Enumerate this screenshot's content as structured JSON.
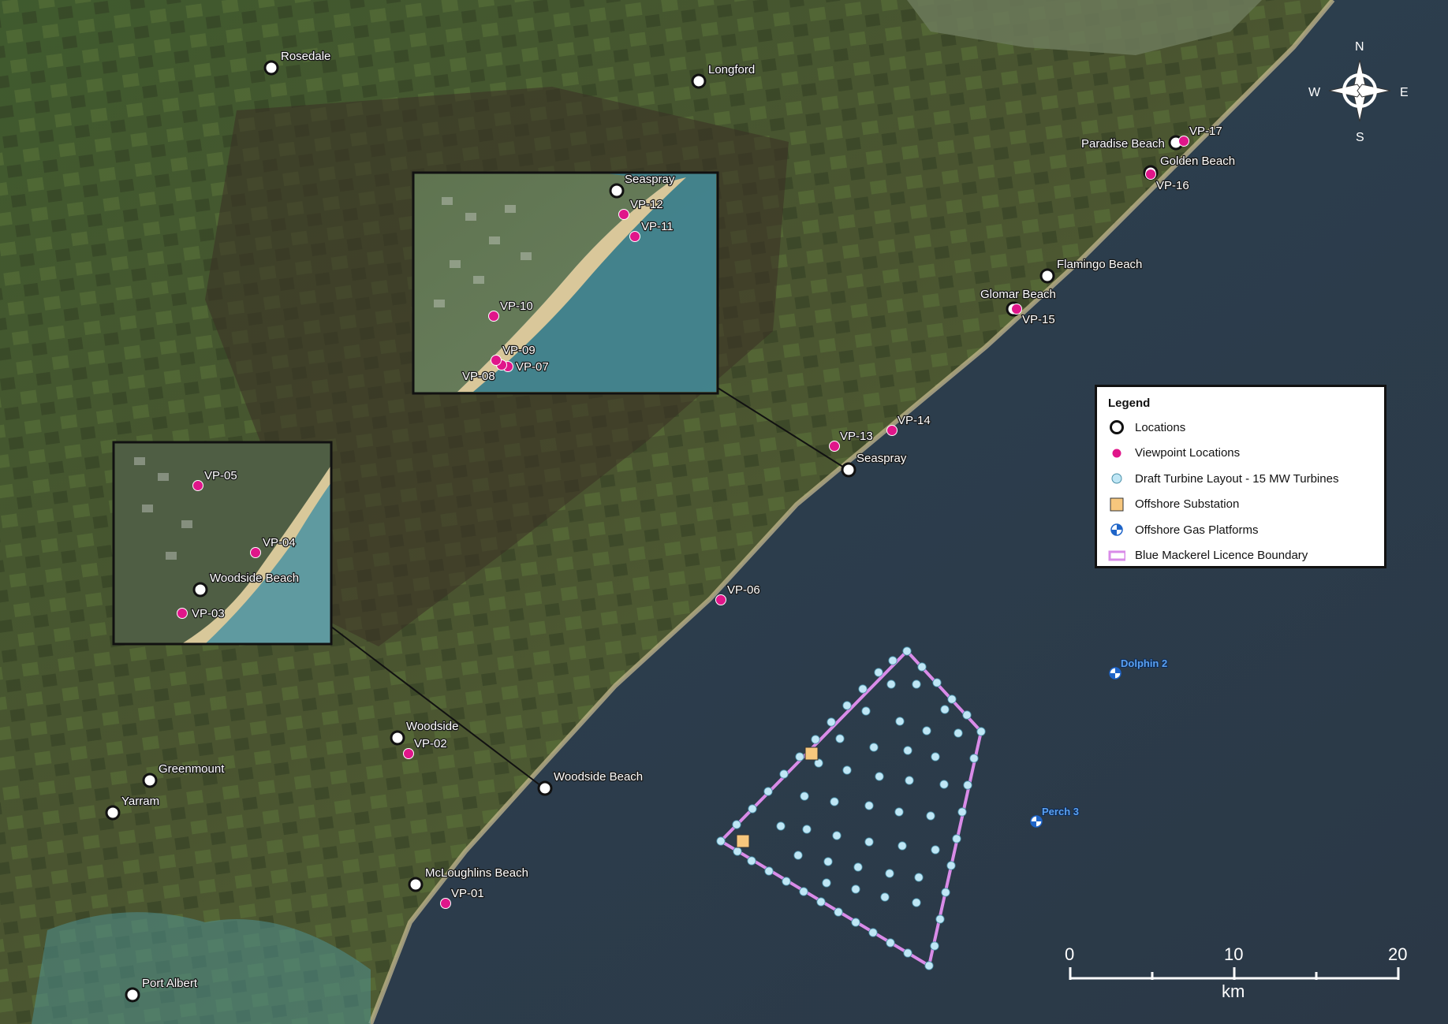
{
  "legend": {
    "title": "Legend",
    "items": [
      {
        "label": "Locations",
        "symbol": "location-circle"
      },
      {
        "label": "Viewpoint Locations",
        "symbol": "viewpoint-dot"
      },
      {
        "label": "Draft Turbine Layout - 15 MW Turbines",
        "symbol": "turbine-dot"
      },
      {
        "label": "Offshore Substation",
        "symbol": "substation-square"
      },
      {
        "label": "Offshore Gas Platforms",
        "symbol": "gas-platform-icon"
      },
      {
        "label": "Blue Mackerel Licence Boundary",
        "symbol": "boundary-rect"
      }
    ]
  },
  "colors": {
    "viewpoint": "#e0168a",
    "turbine": "#bfe6f5",
    "substation": "#f7c77d",
    "boundary": "#d98be8",
    "gas": "#1e64c8",
    "sea": "#2c3c4a"
  },
  "locations": {
    "rosedale": "Rosedale",
    "longford": "Longford",
    "paradise_beach": "Paradise Beach",
    "golden_beach": "Golden Beach",
    "flamingo_beach": "Flamingo Beach",
    "glomar_beach": "Glomar Beach",
    "seaspray": "Seaspray",
    "woodside": "Woodside",
    "woodside_beach": "Woodside Beach",
    "greenmount": "Greenmount",
    "yarram": "Yarram",
    "mcloughlins_beach": "McLoughlins Beach",
    "port_albert": "Port Albert"
  },
  "viewpoints": {
    "vp01": "VP-01",
    "vp02": "VP-02",
    "vp03": "VP-03",
    "vp04": "VP-04",
    "vp05": "VP-05",
    "vp06": "VP-06",
    "vp07": "VP-07",
    "vp08": "VP-08",
    "vp09": "VP-09",
    "vp10": "VP-10",
    "vp11": "VP-11",
    "vp12": "VP-12",
    "vp13": "VP-13",
    "vp14": "VP-14",
    "vp15": "VP-15",
    "vp16": "VP-16",
    "vp17": "VP-17"
  },
  "gas_platforms": {
    "dolphin2": "Dolphin 2",
    "perch3": "Perch 3"
  },
  "scale_bar": {
    "ticks": [
      "0",
      "10",
      "20"
    ],
    "unit": "km"
  },
  "compass": {
    "n": "N",
    "s": "S",
    "e": "E",
    "w": "W"
  }
}
